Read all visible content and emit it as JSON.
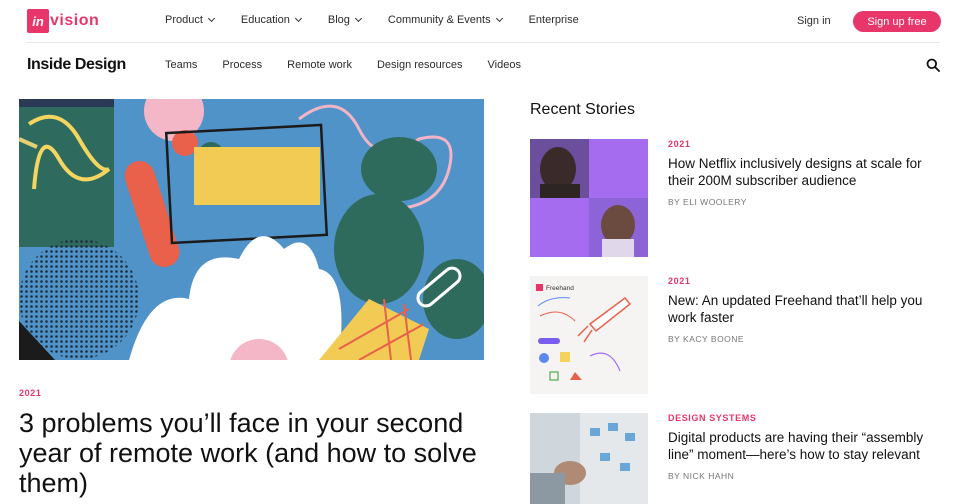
{
  "header": {
    "logo_box": "in",
    "logo_text": "vision",
    "menu": [
      {
        "label": "Product",
        "dropdown": true
      },
      {
        "label": "Education",
        "dropdown": true
      },
      {
        "label": "Blog",
        "dropdown": true
      },
      {
        "label": "Community & Events",
        "dropdown": true
      },
      {
        "label": "Enterprise",
        "dropdown": false
      }
    ],
    "sign_in": "Sign in",
    "sign_up": "Sign up free"
  },
  "subnav": {
    "brand": "Inside Design",
    "items": [
      "Teams",
      "Process",
      "Remote work",
      "Design resources",
      "Videos"
    ]
  },
  "hero": {
    "tag": "2021",
    "title": "3 problems you’ll face in your second year of remote work (and how to solve them)"
  },
  "recent": {
    "heading": "Recent Stories",
    "stories": [
      {
        "tag": "2021",
        "title": "How Netflix inclusively designs at scale for their 200M subscriber audience",
        "author": "BY ELI WOOLERY"
      },
      {
        "tag": "2021",
        "title": "New: An updated Freehand that’ll help you work faster",
        "author": "BY KACY BOONE",
        "thumb_label": "Freehand"
      },
      {
        "tag": "DESIGN SYSTEMS",
        "title": "Digital products are having their “assembly line” moment—here’s how to stay relevant",
        "author": "BY NICK HAHN"
      }
    ]
  },
  "colors": {
    "accent": "#e8366b",
    "hero_bg": "#4f93c9"
  }
}
